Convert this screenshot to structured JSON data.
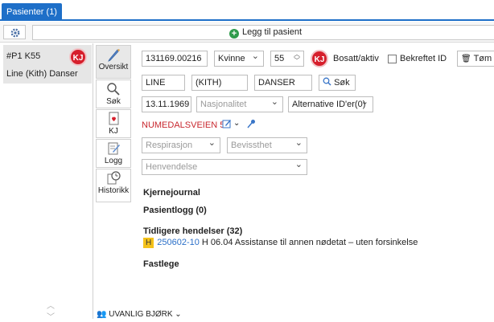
{
  "tabs": [
    {
      "label": "Pasienter (1)"
    }
  ],
  "toolbar": {
    "add_patient_label": "Legg til pasient"
  },
  "patient_card": {
    "id": "#P1 K55",
    "name": "Line (Kith) Danser",
    "badge": "KJ"
  },
  "nav": [
    {
      "label": "Oversikt",
      "icon": "pencil-icon"
    },
    {
      "label": "Søk",
      "icon": "search-icon"
    },
    {
      "label": "KJ",
      "icon": "kj-icon"
    },
    {
      "label": "Logg",
      "icon": "log-icon"
    },
    {
      "label": "Historikk",
      "icon": "history-icon"
    }
  ],
  "form": {
    "ssn": "131169.00216",
    "gender": "Kvinne",
    "age": "55",
    "kj_badge": "KJ",
    "bosatt_label": "Bosatt/aktiv",
    "bekreftet_label": "Bekreftet ID",
    "clear_label": "Tøm",
    "first_name": "LINE",
    "middle_name": "(KITH)",
    "last_name": "DANSER",
    "search_label": "Søk",
    "birth_date": "13.11.1969",
    "nationality_placeholder": "Nasjonalitet",
    "alt_ids": "Alternative ID'er(0)",
    "address": "NUMEDALSVEIEN 52",
    "respiration_placeholder": "Respirasjon",
    "consciousness_placeholder": "Bevissthet",
    "inquiry_placeholder": "Henvendelse"
  },
  "sections": {
    "journal": "Kjernejournal",
    "patient_log": "Pasientlogg (0)",
    "previous_events": "Tidligere hendelser (32)",
    "event": {
      "badge": "H",
      "id": "250602-10",
      "text": "H 06.04  Assistanse til annen nødetat – uten forsinkelse"
    },
    "gp": "Fastlege"
  },
  "footer": {
    "user": "UVANLIG BJØRK"
  },
  "colors": {
    "accent": "#1e6fc8",
    "kj_red": "#d61f2c",
    "address_red": "#c8272e",
    "highlight": "#f4c21b"
  }
}
